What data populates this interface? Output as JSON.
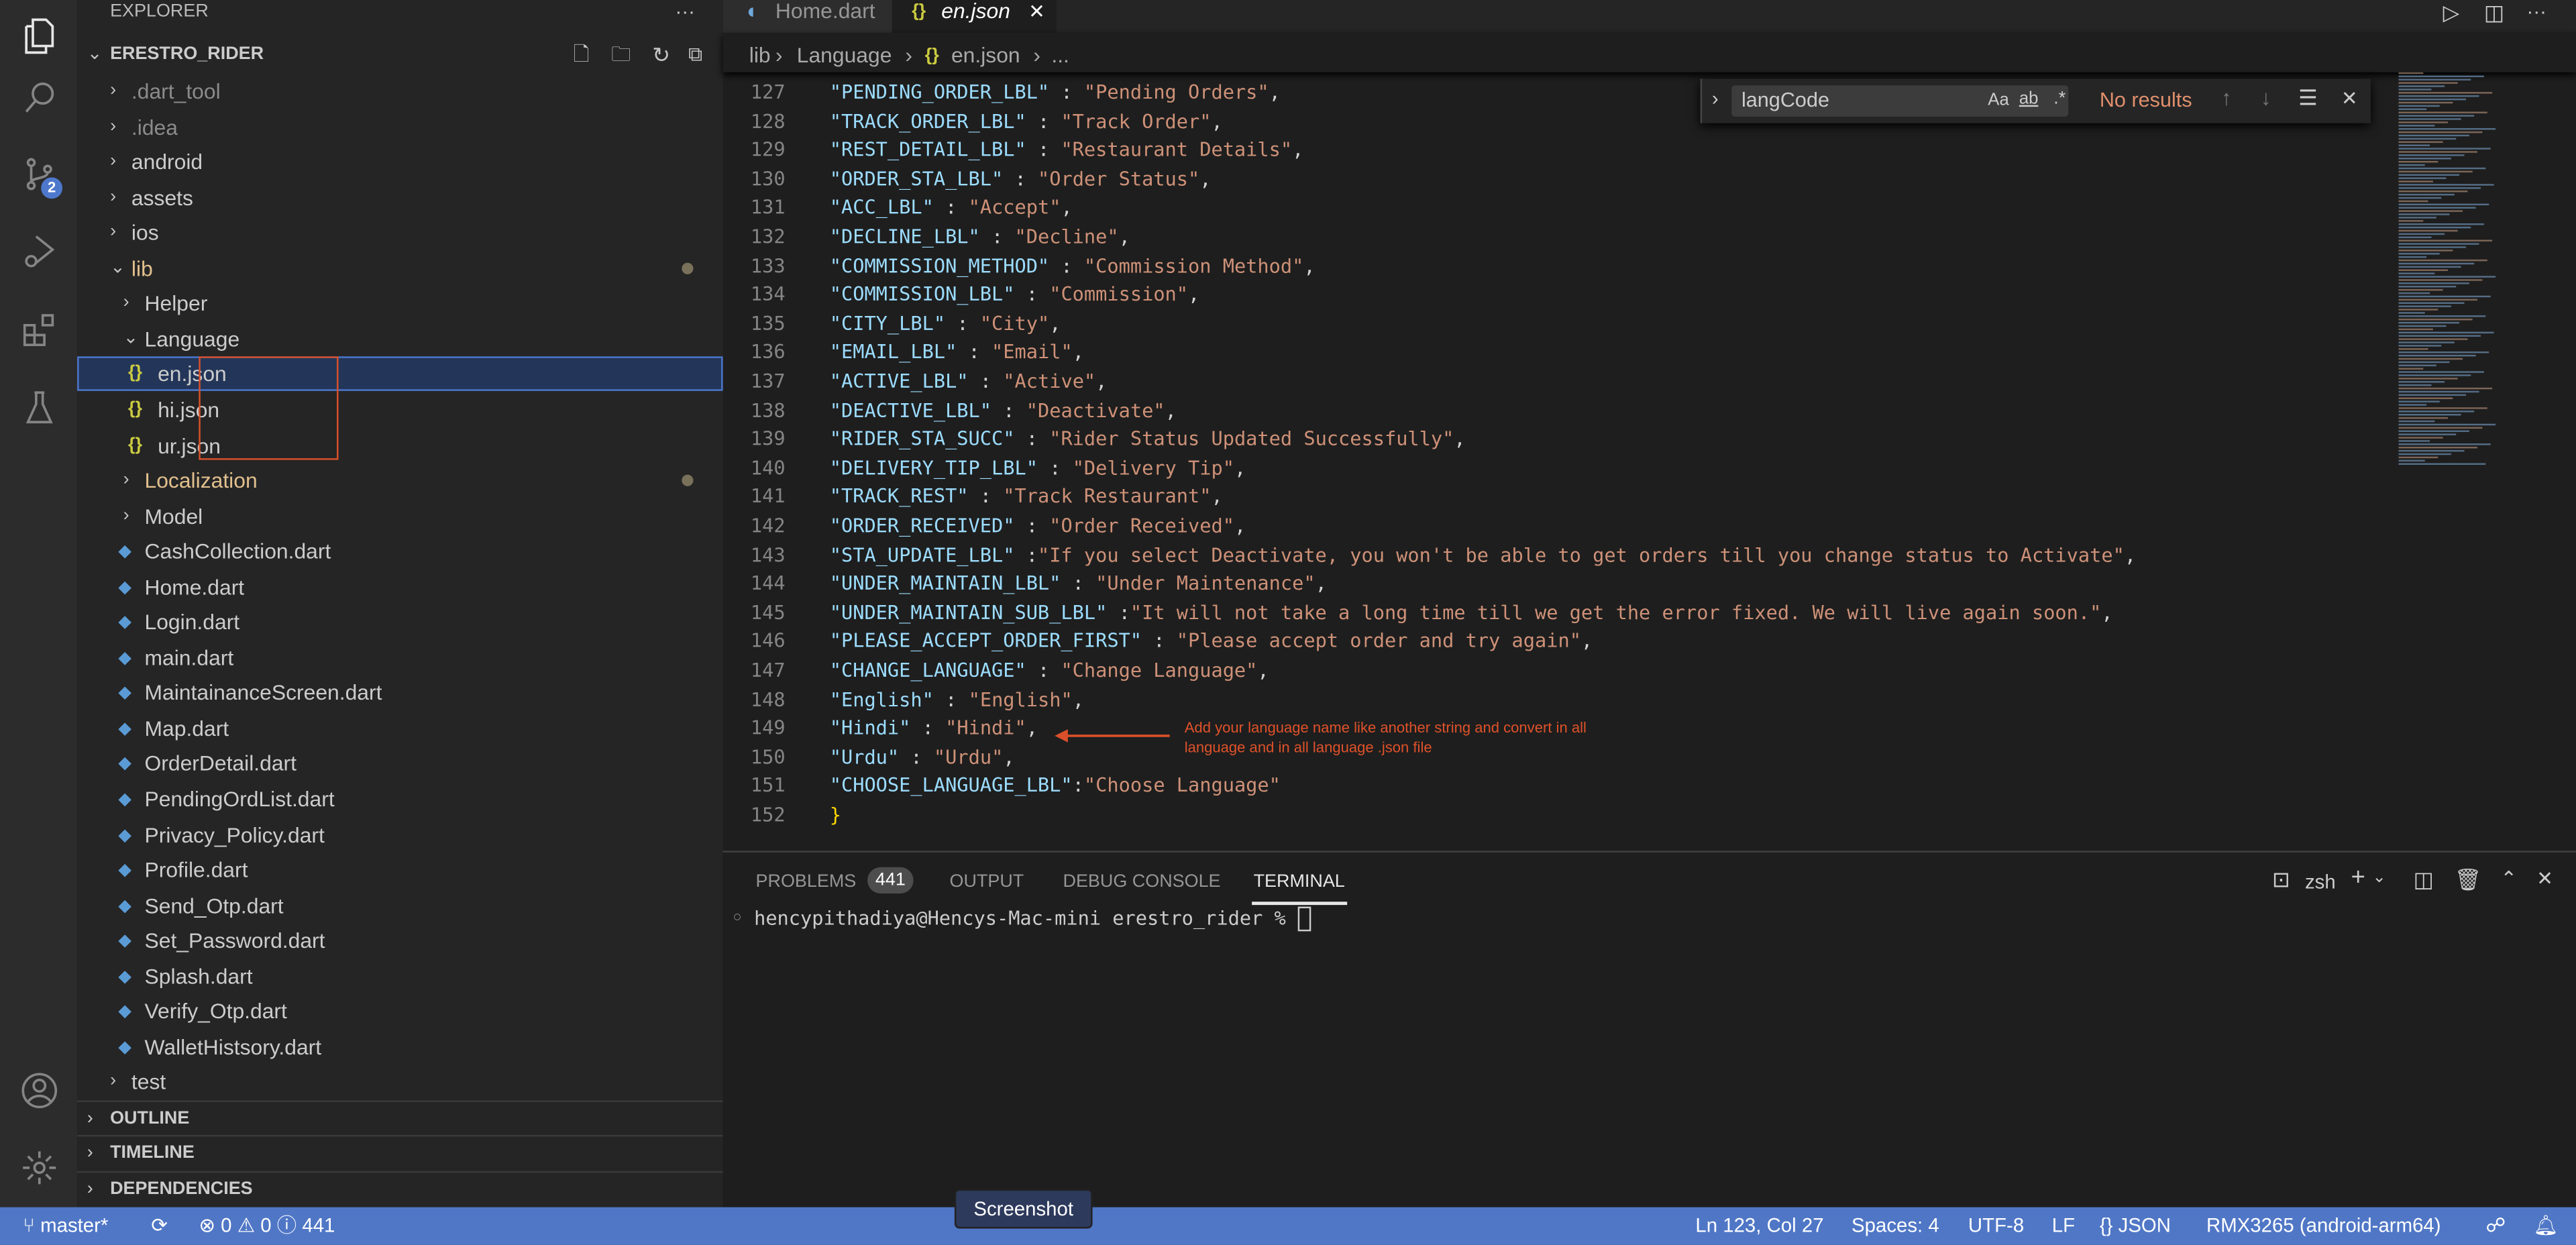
{
  "activity": {
    "scm_badge": "2"
  },
  "sidebar": {
    "title": "EXPLORER",
    "more": "···",
    "project": "ERESTRO_RIDER",
    "items": [
      {
        "label": ".dart_tool",
        "type": "folder",
        "depth": 1,
        "open": false,
        "color": "#8b8b8b"
      },
      {
        "label": ".idea",
        "type": "folder",
        "depth": 1,
        "open": false,
        "color": "#8b8b8b"
      },
      {
        "label": "android",
        "type": "folder",
        "depth": 1,
        "open": false
      },
      {
        "label": "assets",
        "type": "folder",
        "depth": 1,
        "open": false
      },
      {
        "label": "ios",
        "type": "folder",
        "depth": 1,
        "open": false
      },
      {
        "label": "lib",
        "type": "folder",
        "depth": 1,
        "open": true,
        "color": "#e2c08d",
        "dot": true
      },
      {
        "label": "Helper",
        "type": "folder",
        "depth": 2,
        "open": false
      },
      {
        "label": "Language",
        "type": "folder",
        "depth": 2,
        "open": true
      },
      {
        "label": "en.json",
        "type": "json",
        "depth": 3,
        "selected": true
      },
      {
        "label": "hi.json",
        "type": "json",
        "depth": 3
      },
      {
        "label": "ur.json",
        "type": "json",
        "depth": 3
      },
      {
        "label": "Localization",
        "type": "folder",
        "depth": 2,
        "open": false,
        "color": "#e2c08d",
        "dot": true
      },
      {
        "label": "Model",
        "type": "folder",
        "depth": 2,
        "open": false
      },
      {
        "label": "CashCollection.dart",
        "type": "dart",
        "depth": 2
      },
      {
        "label": "Home.dart",
        "type": "dart",
        "depth": 2
      },
      {
        "label": "Login.dart",
        "type": "dart",
        "depth": 2
      },
      {
        "label": "main.dart",
        "type": "dart",
        "depth": 2
      },
      {
        "label": "MaintainanceScreen.dart",
        "type": "dart",
        "depth": 2
      },
      {
        "label": "Map.dart",
        "type": "dart",
        "depth": 2
      },
      {
        "label": "OrderDetail.dart",
        "type": "dart",
        "depth": 2
      },
      {
        "label": "PendingOrdList.dart",
        "type": "dart",
        "depth": 2
      },
      {
        "label": "Privacy_Policy.dart",
        "type": "dart",
        "depth": 2
      },
      {
        "label": "Profile.dart",
        "type": "dart",
        "depth": 2
      },
      {
        "label": "Send_Otp.dart",
        "type": "dart",
        "depth": 2
      },
      {
        "label": "Set_Password.dart",
        "type": "dart",
        "depth": 2
      },
      {
        "label": "Splash.dart",
        "type": "dart",
        "depth": 2
      },
      {
        "label": "Verify_Otp.dart",
        "type": "dart",
        "depth": 2
      },
      {
        "label": "WalletHistsory.dart",
        "type": "dart",
        "depth": 2
      },
      {
        "label": "test",
        "type": "folder",
        "depth": 1,
        "open": false
      }
    ],
    "sections": [
      "OUTLINE",
      "TIMELINE",
      "DEPENDENCIES"
    ]
  },
  "tabs": [
    {
      "label": "Home.dart",
      "active": false
    },
    {
      "label": "en.json",
      "active": true
    }
  ],
  "breadcrumb": [
    "lib",
    "Language",
    "en.json",
    "..."
  ],
  "find": {
    "value": "langCode",
    "result": "No results",
    "opt_case": "Aa",
    "opt_word": "ab",
    "opt_regex": ".*"
  },
  "code": [
    {
      "n": "127",
      "k": "\"PENDING_ORDER_LBL\"",
      "s": " : ",
      "v": "\"Pending Orders\"",
      "c": ","
    },
    {
      "n": "128",
      "k": "\"TRACK_ORDER_LBL\"",
      "s": " : ",
      "v": "\"Track Order\"",
      "c": ","
    },
    {
      "n": "129",
      "k": "\"REST_DETAIL_LBL\"",
      "s": " : ",
      "v": "\"Restaurant Details\"",
      "c": ","
    },
    {
      "n": "130",
      "k": "\"ORDER_STA_LBL\"",
      "s": " : ",
      "v": "\"Order Status\"",
      "c": ","
    },
    {
      "n": "131",
      "k": "\"ACC_LBL\"",
      "s": " : ",
      "v": "\"Accept\"",
      "c": ","
    },
    {
      "n": "132",
      "k": "\"DECLINE_LBL\"",
      "s": " : ",
      "v": "\"Decline\"",
      "c": ","
    },
    {
      "n": "133",
      "k": "\"COMMISSION_METHOD\"",
      "s": " : ",
      "v": "\"Commission Method\"",
      "c": ","
    },
    {
      "n": "134",
      "k": "\"COMMISSION_LBL\"",
      "s": " : ",
      "v": "\"Commission\"",
      "c": ","
    },
    {
      "n": "135",
      "k": "\"CITY_LBL\"",
      "s": " : ",
      "v": "\"City\"",
      "c": ","
    },
    {
      "n": "136",
      "k": "\"EMAIL_LBL\"",
      "s": " : ",
      "v": "\"Email\"",
      "c": ","
    },
    {
      "n": "137",
      "k": "\"ACTIVE_LBL\"",
      "s": " : ",
      "v": "\"Active\"",
      "c": ","
    },
    {
      "n": "138",
      "k": "\"DEACTIVE_LBL\"",
      "s": " : ",
      "v": "\"Deactivate\"",
      "c": ","
    },
    {
      "n": "139",
      "k": "\"RIDER_STA_SUCC\"",
      "s": " : ",
      "v": "\"Rider Status Updated Successfully\"",
      "c": ","
    },
    {
      "n": "140",
      "k": "\"DELIVERY_TIP_LBL\"",
      "s": " : ",
      "v": "\"Delivery Tip\"",
      "c": ","
    },
    {
      "n": "141",
      "k": "\"TRACK_REST\"",
      "s": " : ",
      "v": "\"Track Restaurant\"",
      "c": ","
    },
    {
      "n": "142",
      "k": "\"ORDER_RECEIVED\"",
      "s": " : ",
      "v": "\"Order Received\"",
      "c": ","
    },
    {
      "n": "143",
      "k": "\"STA_UPDATE_LBL\"",
      "s": " :",
      "v": "\"If you select Deactivate, you won't be able to get orders till you change status to Activate\"",
      "c": ","
    },
    {
      "n": "144",
      "k": "\"UNDER_MAINTAIN_LBL\"",
      "s": " : ",
      "v": "\"Under Maintenance\"",
      "c": ","
    },
    {
      "n": "145",
      "k": "\"UNDER_MAINTAIN_SUB_LBL\"",
      "s": " :",
      "v": "\"It will not take a long time till we get the error fixed. We will live again soon.\"",
      "c": ","
    },
    {
      "n": "146",
      "k": "\"PLEASE_ACCEPT_ORDER_FIRST\"",
      "s": " : ",
      "v": "\"Please accept order and try again\"",
      "c": ","
    },
    {
      "n": "147",
      "k": "\"CHANGE_LANGUAGE\"",
      "s": " : ",
      "v": "\"Change Language\"",
      "c": ","
    },
    {
      "n": "148",
      "k": "\"English\"",
      "s": " : ",
      "v": "\"English\"",
      "c": ","
    },
    {
      "n": "149",
      "k": "\"Hindi\"",
      "s": " : ",
      "v": "\"Hindi\"",
      "c": ","
    },
    {
      "n": "150",
      "k": "\"Urdu\"",
      "s": " : ",
      "v": "\"Urdu\"",
      "c": ","
    },
    {
      "n": "151",
      "k": "\"CHOOSE_LANGUAGE_LBL\"",
      "s": ":",
      "v": "\"Choose Language\"",
      "c": ""
    },
    {
      "n": "152",
      "brace": "}"
    }
  ],
  "annotation": {
    "text": "Add your language name like another string and convert in all language and in all language .json file",
    "color": "#d9502a"
  },
  "panel": {
    "tabs": [
      "PROBLEMS",
      "OUTPUT",
      "DEBUG CONSOLE",
      "TERMINAL"
    ],
    "problems_count": "441",
    "active": "TERMINAL",
    "shell": "zsh",
    "prompt": "hencypithadiya@Hencys-Mac-mini erestro_rider % "
  },
  "status": {
    "branch": "master*",
    "errors": "0",
    "warnings": "0",
    "info": "441",
    "position": "Ln 123, Col 27",
    "spaces": "Spaces: 4",
    "encoding": "UTF-8",
    "eol": "LF",
    "language": "JSON",
    "device": "RMX3265 (android-arm64)",
    "color": "#5077c6"
  },
  "tooltip": "Screenshot"
}
